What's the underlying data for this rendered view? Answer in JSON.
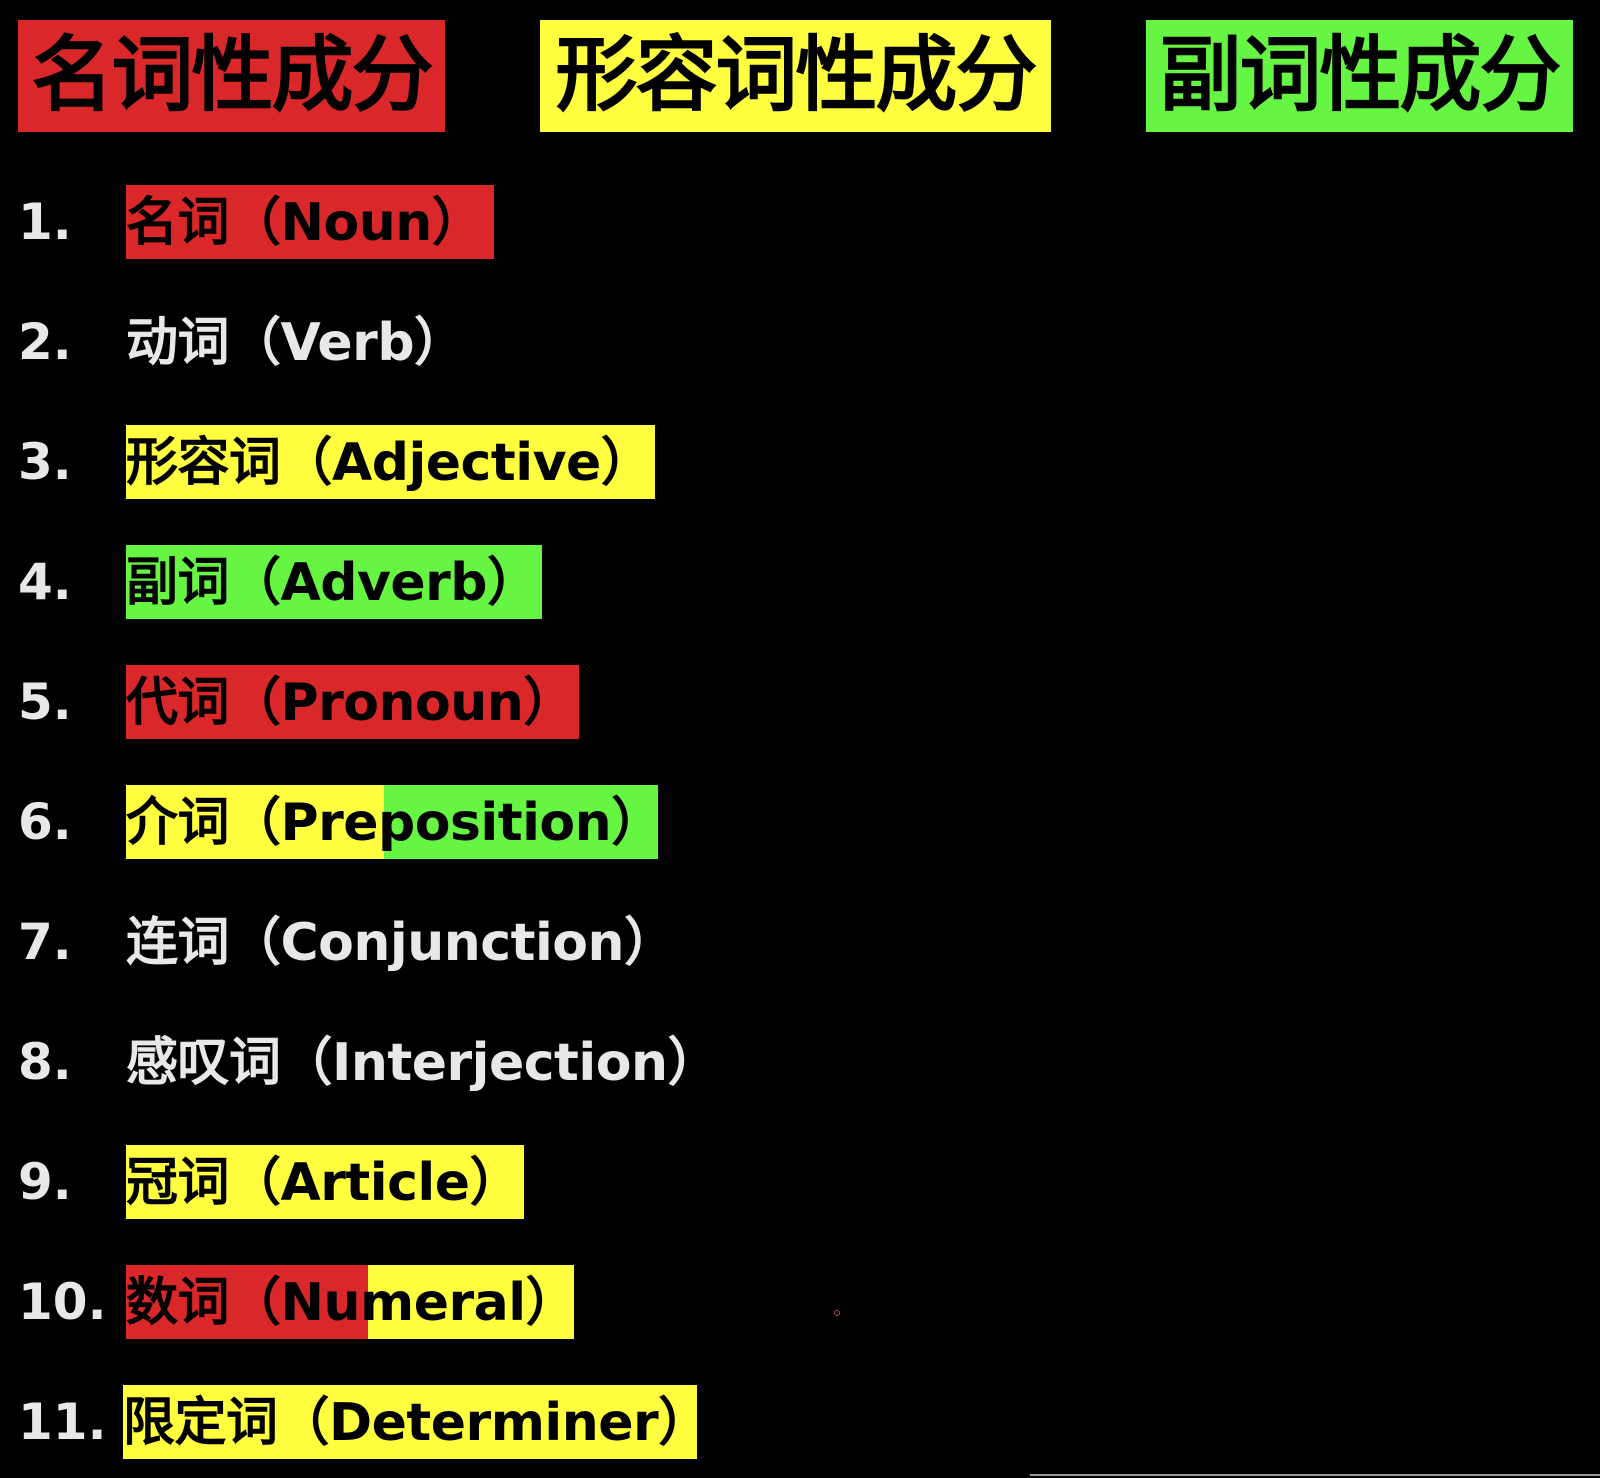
{
  "colors": {
    "background": "#000000",
    "noun_red": "#d9272a",
    "adjective_yellow": "#ffff40",
    "adverb_green": "#66f542",
    "plain_text": "#e8e8e8"
  },
  "headers": {
    "noun": "名词性成分",
    "adjective": "形容词性成分",
    "adverb": "副词性成分"
  },
  "items": [
    {
      "num": "1.",
      "label": "名词（Noun）",
      "highlight": "red"
    },
    {
      "num": "2.",
      "label": "动词（Verb）",
      "highlight": "none"
    },
    {
      "num": "3.",
      "label": "形容词（Adjective）",
      "highlight": "yellow"
    },
    {
      "num": "4.",
      "label": "副词（Adverb）",
      "highlight": "green"
    },
    {
      "num": "5.",
      "label": "代词（Pronoun）",
      "highlight": "red"
    },
    {
      "num": "6.",
      "label": "介词（Preposition）",
      "highlight": "yellow-green"
    },
    {
      "num": "7.",
      "label": "连词（Conjunction）",
      "highlight": "none"
    },
    {
      "num": "8.",
      "label": "感叹词（Interjection）",
      "highlight": "none"
    },
    {
      "num": "9.",
      "label": "冠词（Article）",
      "highlight": "yellow"
    },
    {
      "num": "10.",
      "label": "数词（Numeral）",
      "highlight": "red-yellow"
    },
    {
      "num": "11.",
      "label": "限定词（Determiner）",
      "highlight": "yellow"
    }
  ]
}
